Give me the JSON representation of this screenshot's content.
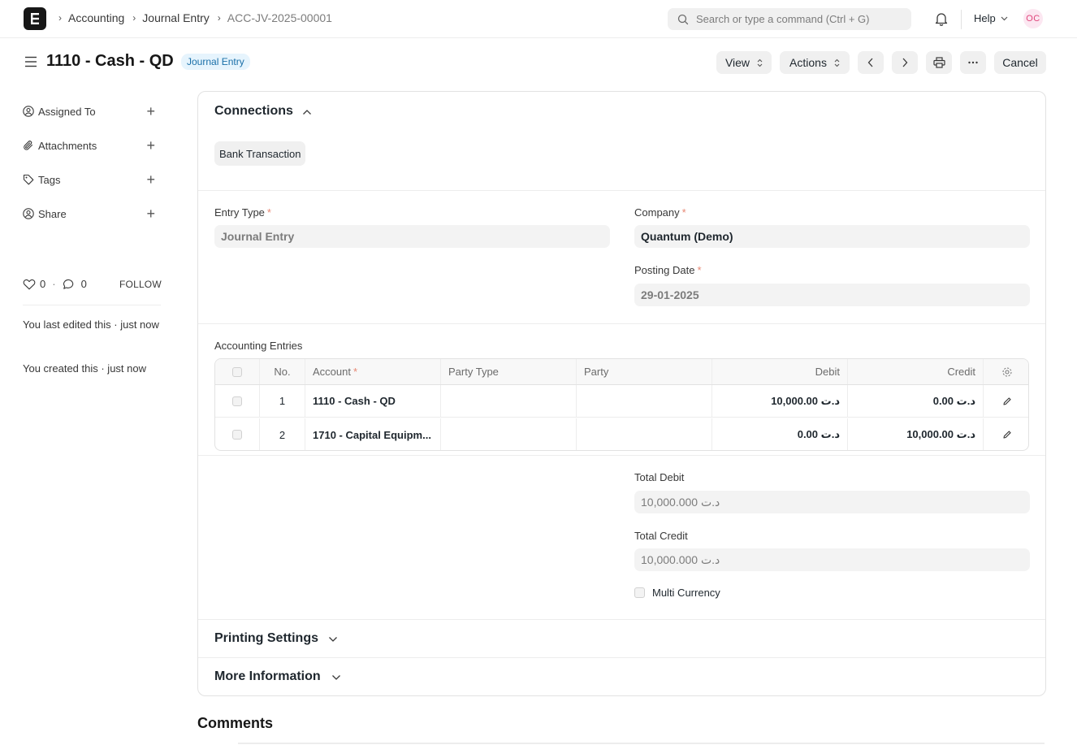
{
  "navbar": {
    "breadcrumbs": [
      "Accounting",
      "Journal Entry",
      "ACC-JV-2025-00001"
    ],
    "search_placeholder": "Search or type a command (Ctrl + G)",
    "help_label": "Help",
    "avatar_initials": "OC"
  },
  "header": {
    "title": "1110 - Cash - QD",
    "status_badge": "Journal Entry",
    "view_label": "View",
    "actions_label": "Actions",
    "cancel_label": "Cancel"
  },
  "sidebar": {
    "items": [
      {
        "label": "Assigned To",
        "icon": "user-plus-icon"
      },
      {
        "label": "Attachments",
        "icon": "paperclip-icon"
      },
      {
        "label": "Tags",
        "icon": "tag-icon"
      },
      {
        "label": "Share",
        "icon": "share-user-icon"
      }
    ],
    "likes": "0",
    "comments_count": "0",
    "follow_label": "FOLLOW",
    "activity": [
      "You last edited this · just now",
      "You created this · just now"
    ]
  },
  "connections": {
    "title": "Connections",
    "items": [
      "Bank Transaction"
    ]
  },
  "form": {
    "entry_type_label": "Entry Type",
    "entry_type_value": "Journal Entry",
    "company_label": "Company",
    "company_value": "Quantum (Demo)",
    "posting_date_label": "Posting Date",
    "posting_date_value": "29-01-2025",
    "accounting_entries_label": "Accounting Entries",
    "total_debit_label": "Total Debit",
    "total_debit_value": "د.ت 10,000.000",
    "total_credit_label": "Total Credit",
    "total_credit_value": "د.ت 10,000.000",
    "multi_currency_label": "Multi Currency"
  },
  "grid": {
    "columns": [
      "No.",
      "Account",
      "Party Type",
      "Party",
      "Debit",
      "Credit"
    ],
    "rows": [
      {
        "no": "1",
        "account": "1110 - Cash - QD",
        "party_type": "",
        "party": "",
        "debit": "د.ت 10,000.00",
        "credit": "د.ت 0.00"
      },
      {
        "no": "2",
        "account": "1710 - Capital Equipm...",
        "party_type": "",
        "party": "",
        "debit": "د.ت 0.00",
        "credit": "د.ت 10,000.00"
      }
    ]
  },
  "sections": {
    "printing_settings": "Printing Settings",
    "more_information": "More Information"
  },
  "comments_title": "Comments",
  "colors": {
    "accent": "#171717",
    "badge_bg": "#e6f4fd",
    "badge_text": "#1a6fa8",
    "required": "#e78773",
    "avatar_bg": "#fce7f1",
    "avatar_text": "#e0457b"
  }
}
